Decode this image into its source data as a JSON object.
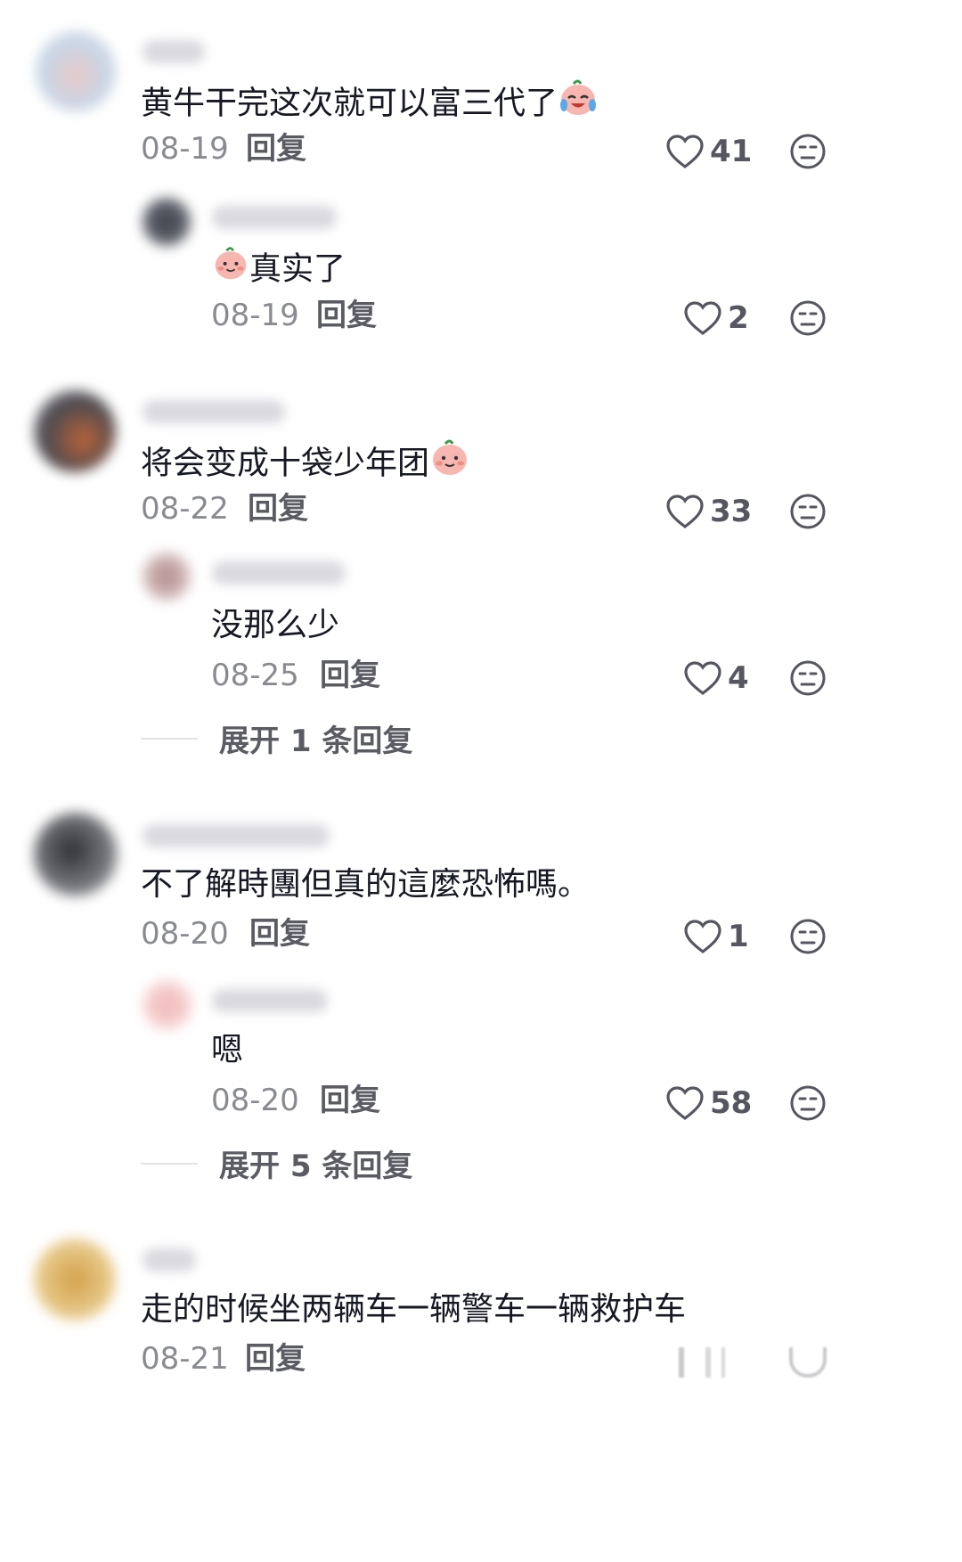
{
  "threads": [
    {
      "comment": {
        "text": "黄牛干完这次就可以富三代了",
        "date": "08-19",
        "reply": "回复",
        "likes": "41",
        "emoji": "laughing-crying-face"
      },
      "replies": [
        {
          "text": "真实了",
          "date": "08-19",
          "reply": "回复",
          "likes": "2",
          "emoji": "blush-face"
        }
      ],
      "expand": ""
    },
    {
      "comment": {
        "text": "将会变成十袋少年团",
        "date": "08-22",
        "reply": "回复",
        "likes": "33",
        "emoji": "blush-face"
      },
      "replies": [
        {
          "text": "没那么少",
          "date": "08-25",
          "reply": "回复",
          "likes": "4"
        }
      ],
      "expand": "展开 1 条回复"
    },
    {
      "comment": {
        "text": "不了解時團但真的這麼恐怖嗎。",
        "date": "08-20",
        "reply": "回复",
        "likes": "1"
      },
      "replies": [
        {
          "text": "嗯",
          "date": "08-20",
          "reply": "回复",
          "likes": "58"
        }
      ],
      "expand": "展开 5 条回复"
    },
    {
      "comment": {
        "text": "走的时候坐两辆车一辆警车一辆救护车",
        "date": "08-21",
        "reply": "回复"
      }
    }
  ],
  "colors": {
    "text": "#161823",
    "meta": "#8a8b91",
    "action": "#5a5b63"
  }
}
